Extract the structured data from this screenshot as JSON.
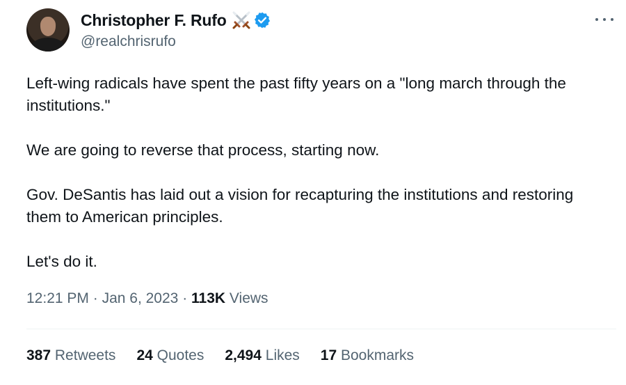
{
  "author": {
    "display_name": "Christopher F. Rufo",
    "handle": "@realchrisrufo",
    "avatar_icon": "profile-photo",
    "emoji_icon": "crossed-swords",
    "verified_icon": "verified-badge",
    "verified_color": "#1d9bf0"
  },
  "more_icon": "more-horizontal-icon",
  "tweet": {
    "paragraphs": [
      "Left-wing radicals have spent the past fifty years on a \"long march through the institutions.\"",
      "We are going to reverse that process, starting now.",
      "Gov. DeSantis has laid out a vision for recapturing the institutions and restoring them to American principles.",
      "Let's do it."
    ]
  },
  "meta": {
    "time": "12:21 PM",
    "separator": "·",
    "date": "Jan 6, 2023",
    "views_count": "113K",
    "views_label": "Views"
  },
  "stats": {
    "retweets_count": "387",
    "retweets_label": "Retweets",
    "quotes_count": "24",
    "quotes_label": "Quotes",
    "likes_count": "2,494",
    "likes_label": "Likes",
    "bookmarks_count": "17",
    "bookmarks_label": "Bookmarks"
  },
  "colors": {
    "text": "#0f1419",
    "secondary": "#536471",
    "divider": "#eff3f4"
  }
}
